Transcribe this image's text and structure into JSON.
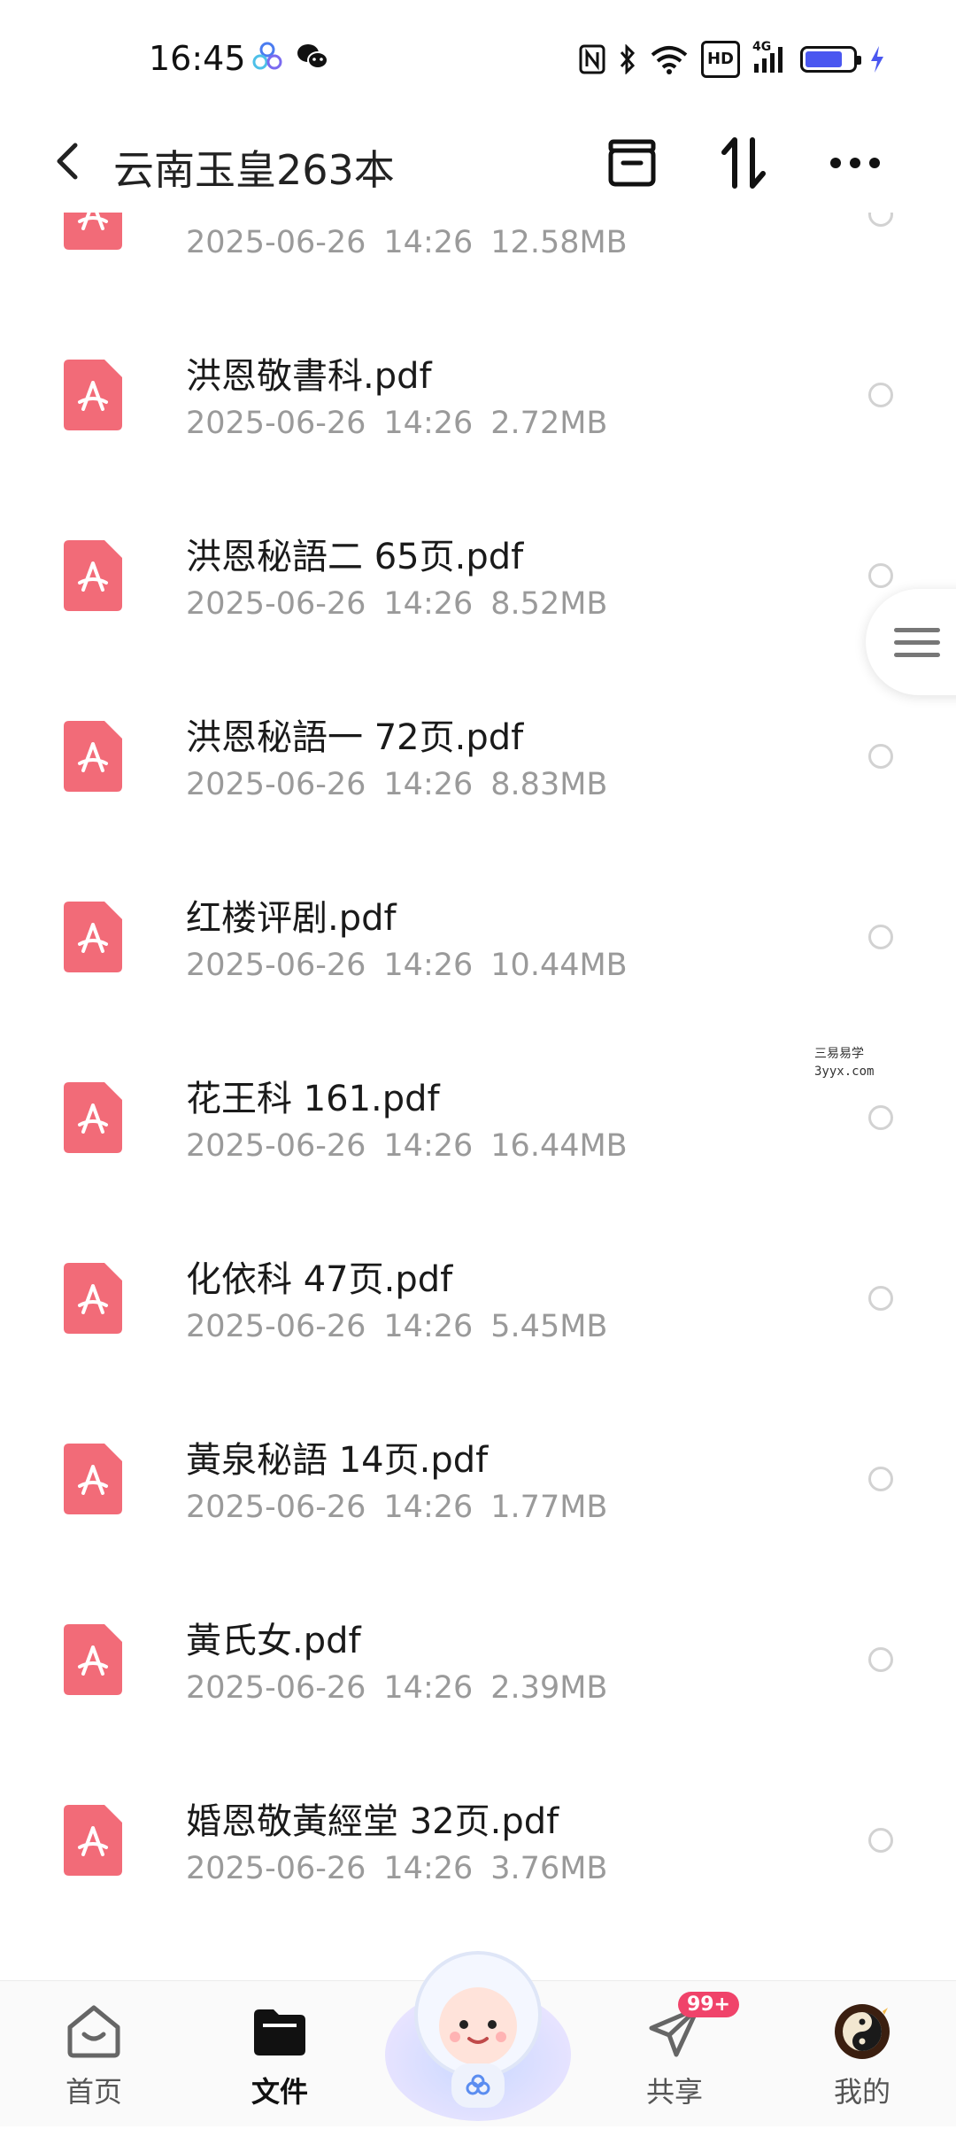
{
  "status_bar": {
    "time": "16:45",
    "network_label": "4G",
    "hd_label": "HD"
  },
  "header": {
    "title": "云南玉皇263本",
    "icons": [
      "back-arrow-icon",
      "archive-icon",
      "sort-icon",
      "more-icon"
    ]
  },
  "files": [
    {
      "name": "",
      "date": "2025-06-26",
      "time": "14:26",
      "size": "12.58MB"
    },
    {
      "name": "洪恩敬書科.pdf",
      "date": "2025-06-26",
      "time": "14:26",
      "size": "2.72MB"
    },
    {
      "name": "洪恩秘語二 65页.pdf",
      "date": "2025-06-26",
      "time": "14:26",
      "size": "8.52MB"
    },
    {
      "name": "洪恩秘語一 72页.pdf",
      "date": "2025-06-26",
      "time": "14:26",
      "size": "8.83MB"
    },
    {
      "name": "红楼评剧.pdf",
      "date": "2025-06-26",
      "time": "14:26",
      "size": "10.44MB"
    },
    {
      "name": "花王科 161.pdf",
      "date": "2025-06-26",
      "time": "14:26",
      "size": "16.44MB"
    },
    {
      "name": "化依科 47页.pdf",
      "date": "2025-06-26",
      "time": "14:26",
      "size": "5.45MB"
    },
    {
      "name": "黃泉秘語 14页.pdf",
      "date": "2025-06-26",
      "time": "14:26",
      "size": "1.77MB"
    },
    {
      "name": "黃氏女.pdf",
      "date": "2025-06-26",
      "time": "14:26",
      "size": "2.39MB"
    },
    {
      "name": "婚恩敬黃經堂 32页.pdf",
      "date": "2025-06-26",
      "time": "14:26",
      "size": "3.76MB"
    }
  ],
  "watermark": {
    "line1": "三易易学",
    "line2": "3yyx.com"
  },
  "bottom_nav": {
    "home": "首页",
    "files": "文件",
    "share": "共享",
    "share_badge": "99+",
    "mine": "我的"
  },
  "colors": {
    "pdf_red": "#f26b78",
    "badge": "#f0436a",
    "battery": "#4a57f0"
  }
}
